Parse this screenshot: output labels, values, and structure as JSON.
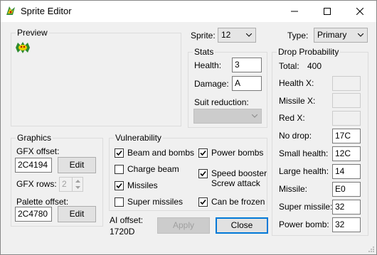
{
  "window": {
    "title": "Sprite Editor"
  },
  "preview": {
    "legend": "Preview"
  },
  "sprite": {
    "label": "Sprite:",
    "value": "12"
  },
  "type": {
    "label": "Type:",
    "value": "Primary"
  },
  "stats": {
    "legend": "Stats",
    "health_label": "Health:",
    "health_value": "3",
    "damage_label": "Damage:",
    "damage_value": "A",
    "suit_label": "Suit reduction:",
    "suit_value": ""
  },
  "graphics": {
    "legend": "Graphics",
    "gfx_offset_label": "GFX offset:",
    "gfx_offset_value": "2C4194",
    "gfx_edit_label": "Edit",
    "gfx_rows_label": "GFX rows:",
    "gfx_rows_value": "2",
    "palette_label": "Palette offset:",
    "palette_value": "2C4780",
    "palette_edit_label": "Edit"
  },
  "vulnerability": {
    "legend": "Vulnerability",
    "items": [
      {
        "label": "Beam and bombs",
        "checked": true
      },
      {
        "label": "Charge beam",
        "checked": false
      },
      {
        "label": "Missiles",
        "checked": true
      },
      {
        "label": "Super missiles",
        "checked": false
      },
      {
        "label": "Power bombs",
        "checked": true
      },
      {
        "label": "Speed booster\nScrew attack",
        "checked": true
      },
      {
        "label": "Can be frozen",
        "checked": true
      }
    ]
  },
  "ai": {
    "label": "AI offset:",
    "value": "1720D"
  },
  "buttons": {
    "apply": "Apply",
    "close": "Close"
  },
  "drop": {
    "legend": "Drop Probability",
    "total_label": "Total:",
    "total_value": "400",
    "healthx_label": "Health X:",
    "healthx_value": "",
    "missilex_label": "Missile X:",
    "missilex_value": "",
    "redx_label": "Red X:",
    "redx_value": "",
    "nodrop_label": "No drop:",
    "nodrop_value": "17C",
    "small_label": "Small health:",
    "small_value": "12C",
    "large_label": "Large health:",
    "large_value": "14",
    "missile_label": "Missile:",
    "missile_value": "E0",
    "super_label": "Super missile:",
    "super_value": "32",
    "power_label": "Power bomb:",
    "power_value": "32"
  }
}
